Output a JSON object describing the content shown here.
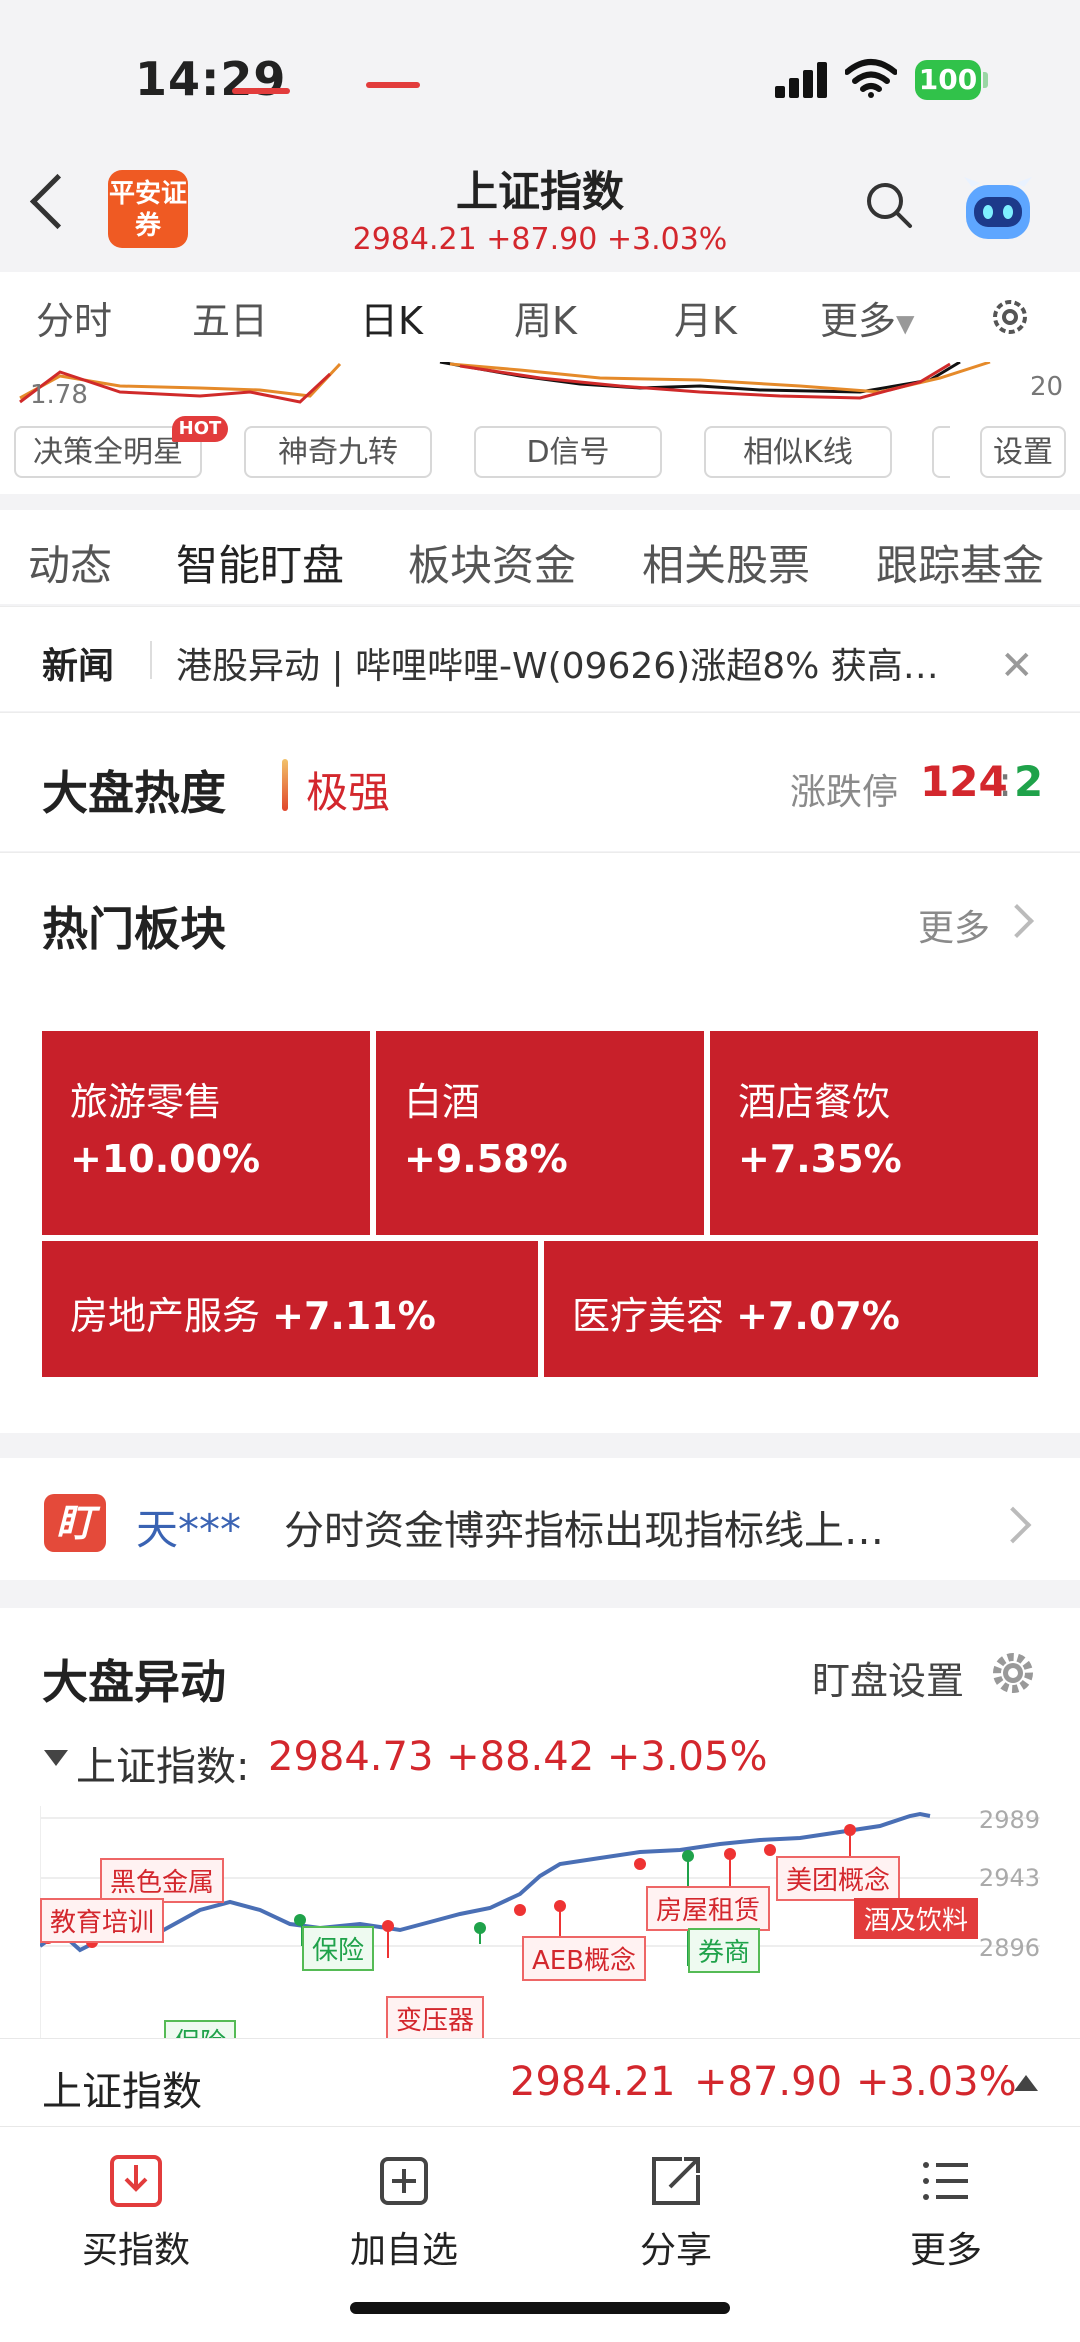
{
  "status_bar": {
    "time": "14:29",
    "battery": "100"
  },
  "header": {
    "logo_text": "平安证券",
    "title": "上证指数",
    "price": "2984.21",
    "change": "+87.90",
    "change_pct": "+3.03%"
  },
  "period_tabs": [
    "分时",
    "五日",
    "日K",
    "周K",
    "月K",
    "更多"
  ],
  "active_period": "日K",
  "mini_chart": {
    "left_label": "1.78",
    "right_label": "20"
  },
  "indicators": {
    "buttons": [
      "决策全明星",
      "神奇九转",
      "D信号",
      "相似K线"
    ],
    "hot_badge": "HOT",
    "settings": "设置"
  },
  "section_tabs": [
    "动态",
    "智能盯盘",
    "板块资金",
    "相关股票",
    "跟踪基金"
  ],
  "active_section": "智能盯盘",
  "news": {
    "label": "新闻",
    "text": "港股异动 | 哔哩哔哩-W(09626)涨超8% 获高…"
  },
  "market_heat": {
    "title": "大盘热度",
    "level": "极强",
    "limit_label": "涨跌停",
    "limit_up": "124",
    "separator": ":",
    "limit_down": "2"
  },
  "hot_sectors": {
    "title": "热门板块",
    "more": "更多",
    "items": [
      {
        "name": "旅游零售",
        "pct": "+10.00%"
      },
      {
        "name": "白酒",
        "pct": "+9.58%"
      },
      {
        "name": "酒店餐饮",
        "pct": "+7.35%"
      },
      {
        "name": "房地产服务",
        "pct": "+7.11%"
      },
      {
        "name": "医疗美容",
        "pct": "+7.07%"
      }
    ]
  },
  "strategy": {
    "logo": "盯",
    "user": "天***",
    "text": "分时资金博弈指标出现指标线上…"
  },
  "market_movement": {
    "title": "大盘异动",
    "setting": "盯盘设置",
    "index_name": "上证指数:",
    "index_price": "2984.73 +88.42 +3.05%",
    "y_ticks": [
      "2989",
      "2943",
      "2896"
    ],
    "labels": [
      "黑色金属",
      "教育培训",
      "保险",
      "保险",
      "变压器",
      "AEB概念",
      "房屋租赁",
      "券商",
      "美团概念",
      "酒及饮料"
    ]
  },
  "bottom_quote": {
    "name": "上证指数",
    "price": "2984.21",
    "change": "+87.90",
    "change_pct": "+3.03%"
  },
  "nav": [
    "买指数",
    "加自选",
    "分享",
    "更多"
  ],
  "colors": {
    "up": "#d3272d",
    "down": "#1fa24a",
    "tile": "#c8202a",
    "accent": "#e23c3c"
  }
}
